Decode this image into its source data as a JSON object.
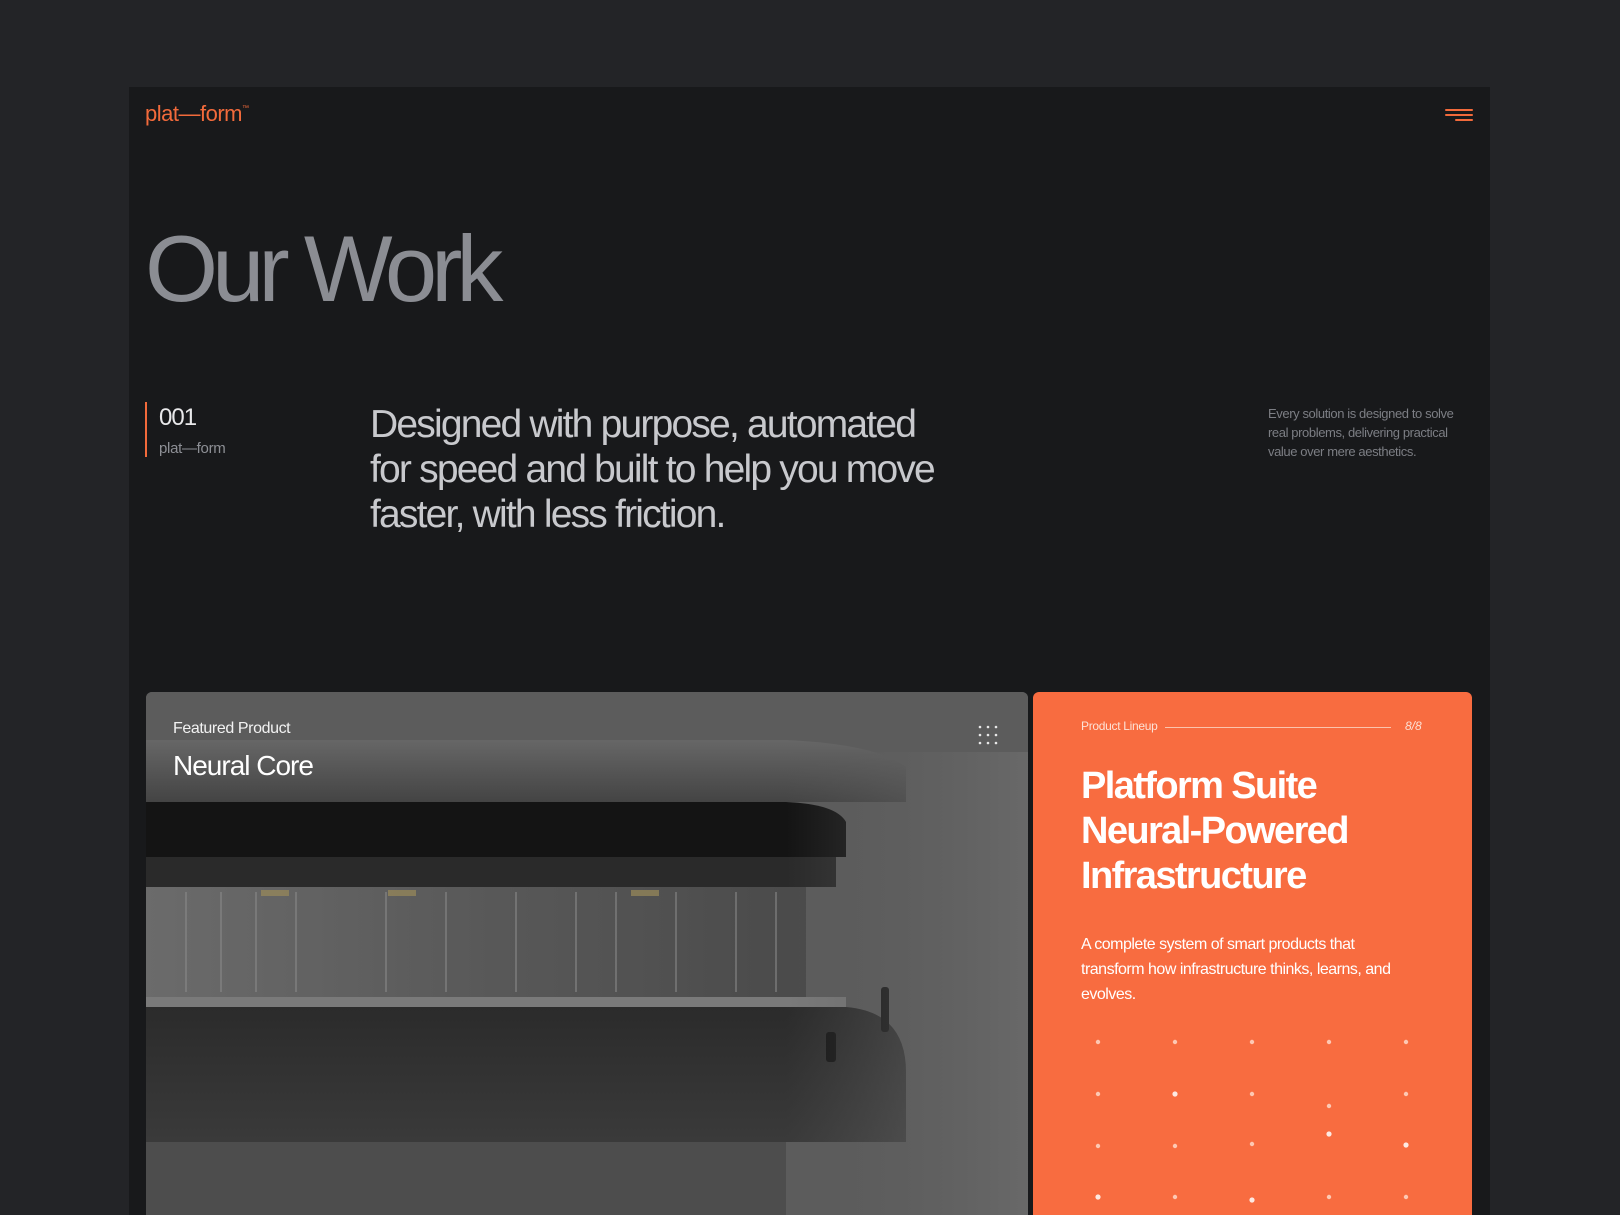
{
  "brand": {
    "logo": "plat—form",
    "trademark": "™",
    "accent": "#f26a3b"
  },
  "header": {
    "menu_icon": "menu-icon"
  },
  "hero": {
    "title": "Our Work"
  },
  "intro": {
    "section_number": "001",
    "section_label": "plat—form",
    "headline": "Designed with purpose, automated for speed and built to help you move faster, with less friction.",
    "side_note": "Every solution is designed to solve real problems, delivering practical value over mere aesthetics."
  },
  "featured": {
    "label": "Featured Product",
    "title": "Neural Core",
    "grid_icon": "grid-icon"
  },
  "lineup": {
    "label": "Product Lineup",
    "count": "8/8",
    "title_lines": [
      "Platform Suite",
      "Neural-Powered",
      "Infrastructure"
    ],
    "description": "A complete system of smart products that transform how infrastructure thinks, learns, and evolves.",
    "background": "#f86c40"
  }
}
